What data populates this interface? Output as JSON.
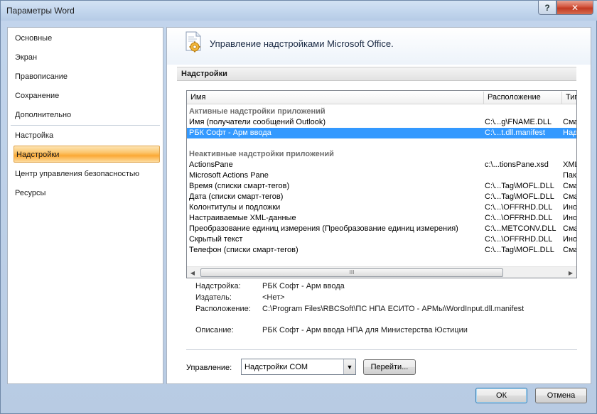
{
  "window": {
    "title": "Параметры Word",
    "help_glyph": "?",
    "close_glyph": "✕"
  },
  "sidebar": {
    "items": [
      {
        "label": "Основные"
      },
      {
        "label": "Экран"
      },
      {
        "label": "Правописание"
      },
      {
        "label": "Сохранение"
      },
      {
        "label": "Дополнительно"
      },
      {
        "label": "Настройка"
      },
      {
        "label": "Надстройки",
        "selected": true
      },
      {
        "label": "Центр управления безопасностью"
      },
      {
        "label": "Ресурсы"
      }
    ]
  },
  "banner": {
    "text": "Управление надстройками Microsoft Office."
  },
  "section": {
    "title": "Надстройки"
  },
  "list": {
    "columns": [
      "Имя",
      "Расположение",
      "Тип"
    ],
    "active_group": "Активные надстройки приложений",
    "active_rows": [
      {
        "name": "Имя (получатели сообщений Outlook)",
        "location": "C:\\...g\\FNAME.DLL",
        "type": "Сма"
      },
      {
        "name": "РБК Софт - Арм ввода",
        "location": "C:\\...t.dll.manifest",
        "type": "Над",
        "selected": true
      }
    ],
    "inactive_group": "Неактивные надстройки приложений",
    "inactive_rows": [
      {
        "name": "ActionsPane",
        "location": "c:\\...tionsPane.xsd",
        "type": "XML"
      },
      {
        "name": "Microsoft Actions Pane",
        "location": "",
        "type": "Пак"
      },
      {
        "name": "Время (списки смарт-тегов)",
        "location": "C:\\...Tag\\MOFL.DLL",
        "type": "Сма"
      },
      {
        "name": "Дата (списки смарт-тегов)",
        "location": "C:\\...Tag\\MOFL.DLL",
        "type": "Сма"
      },
      {
        "name": "Колонтитулы и подложки",
        "location": "C:\\...\\OFFRHD.DLL",
        "type": "Ино"
      },
      {
        "name": "Настраиваемые XML-данные",
        "location": "C:\\...\\OFFRHD.DLL",
        "type": "Ино"
      },
      {
        "name": "Преобразование единиц измерения (Преобразование единиц измерения)",
        "location": "C:\\...METCONV.DLL",
        "type": "Сма"
      },
      {
        "name": "Скрытый текст",
        "location": "C:\\...\\OFFRHD.DLL",
        "type": "Ино"
      },
      {
        "name": "Телефон (списки смарт-тегов)",
        "location": "C:\\...Tag\\MOFL.DLL",
        "type": "Сма"
      }
    ],
    "scroll_left": "◀",
    "scroll_right": "▶",
    "scroll_grip": "III"
  },
  "details": {
    "addin_label": "Надстройка:",
    "addin_value": "РБК Софт - Арм ввода",
    "publisher_label": "Издатель:",
    "publisher_value": "<Нет>",
    "location_label": "Расположение:",
    "location_value": "C:\\Program Files\\RBCSoft\\ПС НПА ЕСИТО - АРМы\\WordInput.dll.manifest",
    "description_label": "Описание:",
    "description_value": "РБК Софт - Арм ввода НПА для Министерства Юстиции"
  },
  "manage": {
    "label": "Управление:",
    "selected": "Надстройки COM",
    "dropdown_glyph": "▼",
    "go_button": "Перейти..."
  },
  "footer": {
    "ok": "ОК",
    "cancel": "Отмена"
  }
}
